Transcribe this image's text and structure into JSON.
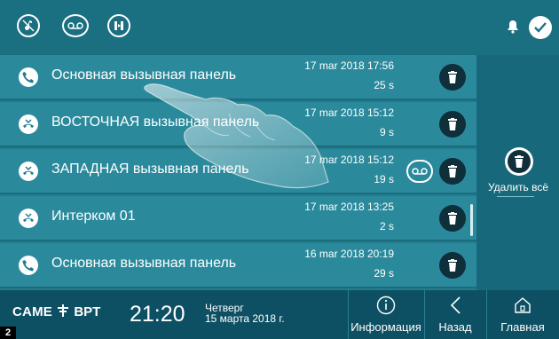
{
  "topbar": {
    "icons": [
      "mute-ringtone-icon",
      "voicemail-icon",
      "do-not-disturb-icon"
    ],
    "bell": "bell-icon",
    "check": "check-icon"
  },
  "calls": [
    {
      "name": "Основная вызывная панель",
      "date": "17 mar 2018 17:56",
      "duration": "25 s",
      "type": "answered",
      "voicemail": false
    },
    {
      "name": "ВОСТОЧНАЯ вызывная панель",
      "date": "17 mar 2018 15:12",
      "duration": "9 s",
      "type": "missed",
      "voicemail": false
    },
    {
      "name": "ЗАПАДНАЯ вызывная панель",
      "date": "17 mar 2018 15:12",
      "duration": "19 s",
      "type": "missed",
      "voicemail": true
    },
    {
      "name": "Интерком 01",
      "date": "17 mar 2018 13:25",
      "duration": "2 s",
      "type": "missed",
      "voicemail": false
    },
    {
      "name": "Основная вызывная панель",
      "date": "16 mar 2018 20:19",
      "duration": "29 s",
      "type": "answered",
      "voicemail": false
    }
  ],
  "right_panel": {
    "delete_all_label": "Удалить всё"
  },
  "status": {
    "brand_came": "CAME",
    "brand_bpt": "BPT",
    "time": "21:20",
    "day": "Четверг",
    "date": "15 марта 2018 г."
  },
  "nav": {
    "info": "Информация",
    "back": "Назад",
    "home": "Главная"
  },
  "badge": "2",
  "colors": {
    "primary": "#1f7c8e",
    "bar": "#0e5063",
    "trash": "#0f2f3a"
  }
}
